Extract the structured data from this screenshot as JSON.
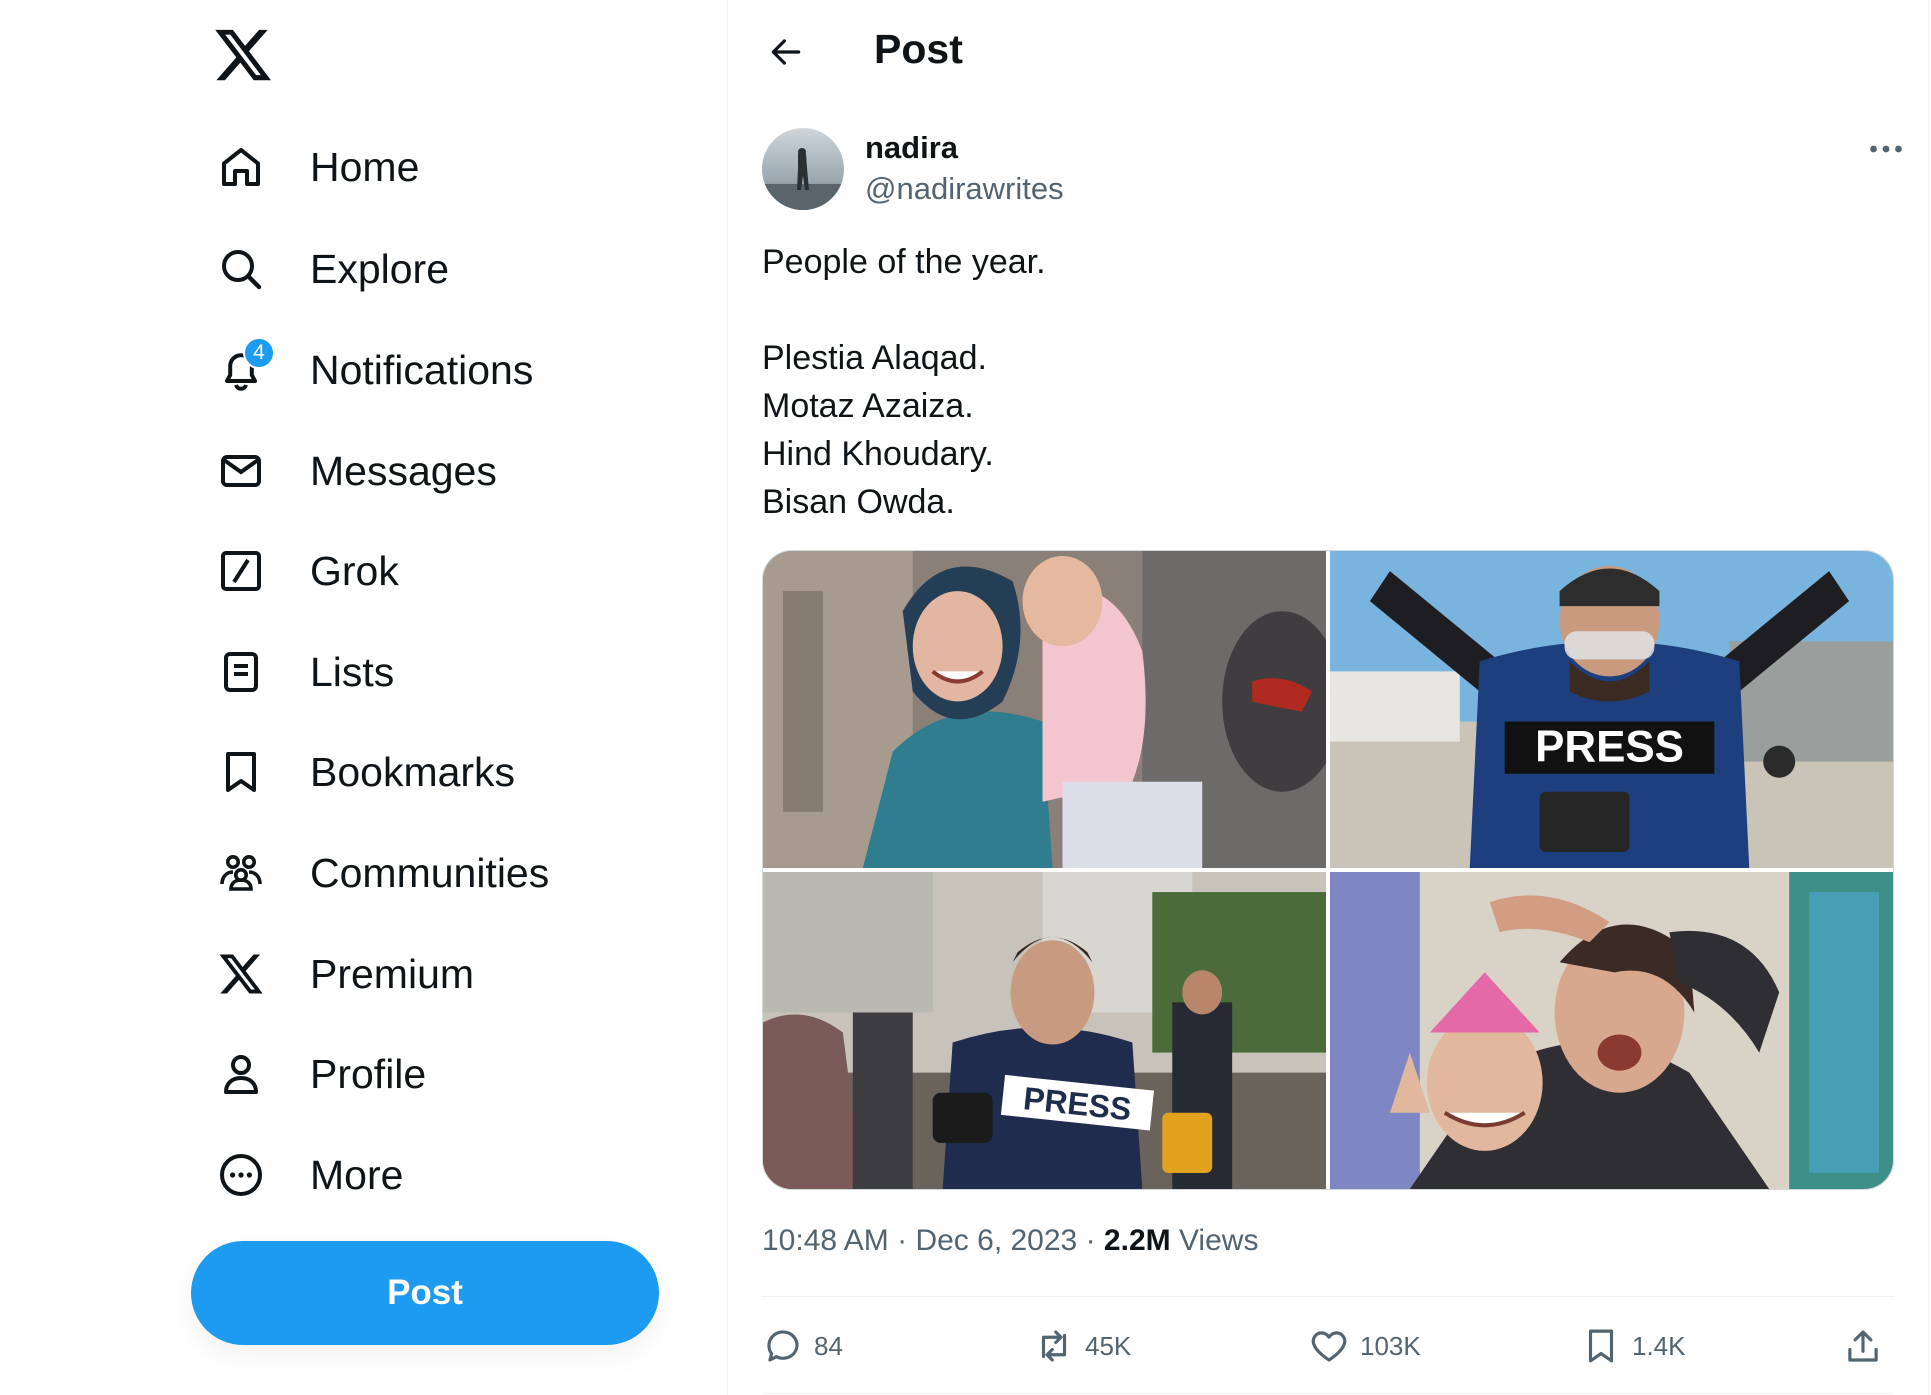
{
  "sidebar": {
    "logo_icon": "x-logo-icon",
    "items": [
      {
        "label": "Home",
        "icon": "home-icon"
      },
      {
        "label": "Explore",
        "icon": "search-icon"
      },
      {
        "label": "Notifications",
        "icon": "bell-icon",
        "badge": "4"
      },
      {
        "label": "Messages",
        "icon": "mail-icon"
      },
      {
        "label": "Grok",
        "icon": "grok-icon"
      },
      {
        "label": "Lists",
        "icon": "list-icon"
      },
      {
        "label": "Bookmarks",
        "icon": "bookmark-icon"
      },
      {
        "label": "Communities",
        "icon": "communities-icon"
      },
      {
        "label": "Premium",
        "icon": "x-premium-icon"
      },
      {
        "label": "Profile",
        "icon": "person-icon"
      },
      {
        "label": "More",
        "icon": "more-circle-icon"
      }
    ],
    "post_button": "Post"
  },
  "header": {
    "title": "Post",
    "back_icon": "arrow-left-icon"
  },
  "post": {
    "author": {
      "name": "nadira",
      "handle": "@nadirawrites"
    },
    "text_lines": [
      "People of the year.",
      "",
      "Plestia Alaqad.",
      "Motaz Azaiza.",
      "Hind Khoudary.",
      "Bisan Owda."
    ],
    "photo_count": 4,
    "press_label": "PRESS",
    "time": "10:48 AM",
    "date": "Dec 6, 2023",
    "separator": "·",
    "views_count": "2.2M",
    "views_label": "Views",
    "actions": {
      "replies": "84",
      "reposts": "45K",
      "likes": "103K",
      "bookmarks": "1.4K"
    }
  },
  "colors": {
    "accent": "#1d9bf0",
    "text_primary": "#0f1419",
    "text_secondary": "#536471",
    "border": "#eff3f4"
  }
}
